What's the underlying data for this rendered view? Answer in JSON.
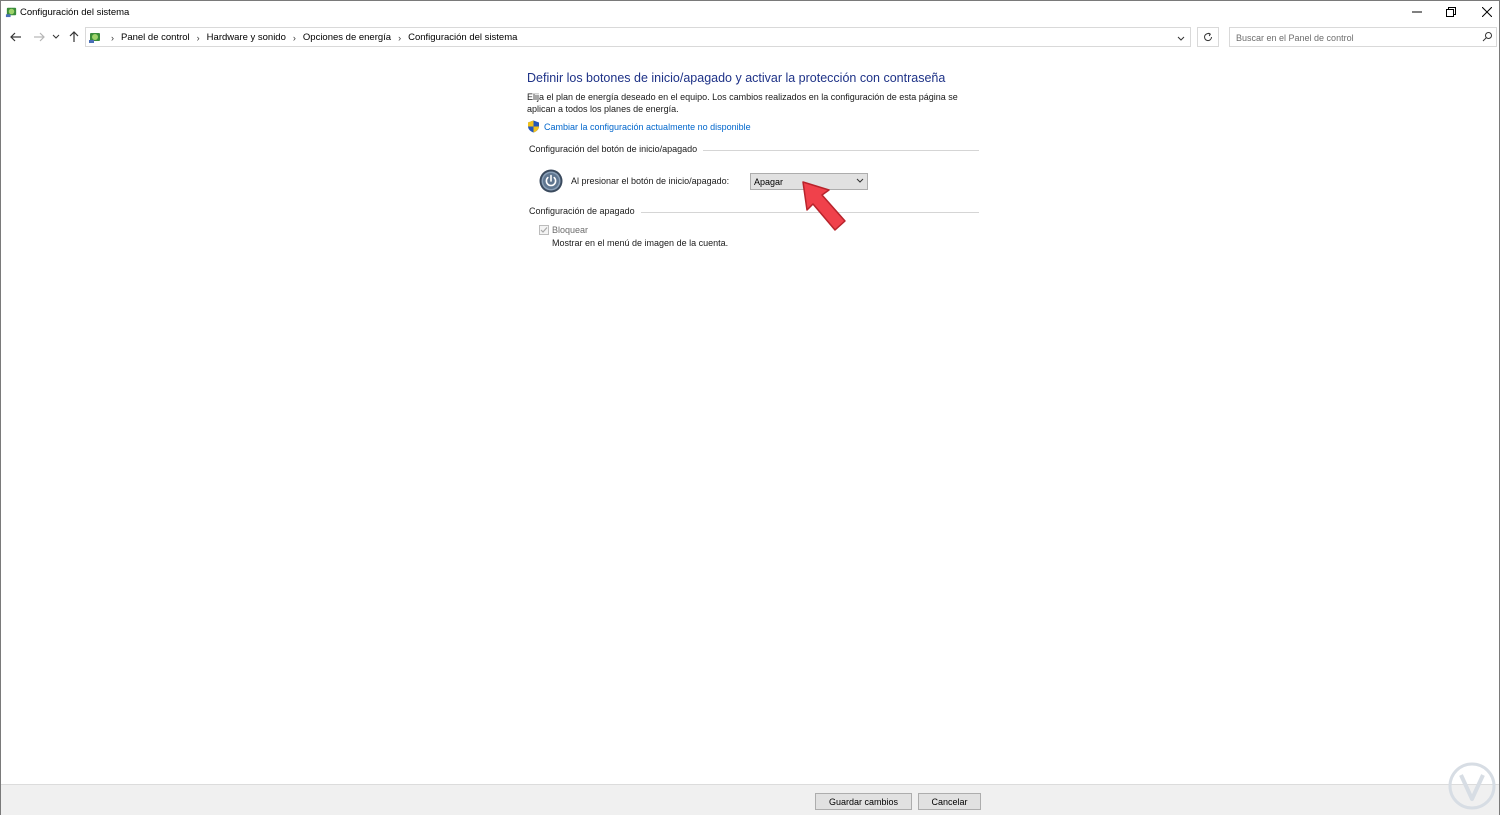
{
  "window": {
    "title": "Configuración del sistema",
    "app_icon": "control-panel-icon"
  },
  "navigation": {
    "back_icon": "arrow-left-icon",
    "forward_icon": "arrow-right-icon",
    "recent_icon": "chevron-down-icon",
    "up_icon": "arrow-up-icon",
    "breadcrumbs": [
      "Panel de control",
      "Hardware y sonido",
      "Opciones de energía",
      "Configuración del sistema"
    ],
    "search_placeholder": "Buscar en el Panel de control"
  },
  "main": {
    "title": "Definir los botones de inicio/apagado y activar la protección con contraseña",
    "description_line1": "Elija el plan de energía deseado en el equipo. Los cambios realizados en la configuración de esta página se",
    "description_line2": "aplican a todos los planes de energía.",
    "change_link": "Cambiar la configuración actualmente no disponible",
    "power_section": {
      "heading": "Configuración del botón de inicio/apagado",
      "label": "Al presionar el botón de inicio/apagado:",
      "selected": "Apagar"
    },
    "shutdown_section": {
      "heading": "Configuración de apagado",
      "lock_label": "Bloquear",
      "lock_checked": true,
      "lock_enabled": false,
      "lock_description": "Mostrar en el menú de imagen de la cuenta."
    }
  },
  "footer": {
    "save_label": "Guardar cambios",
    "cancel_label": "Cancelar"
  },
  "colors": {
    "title_blue": "#1e3287",
    "link_blue": "#0066cc",
    "annotation_arrow": "#f0414b"
  }
}
